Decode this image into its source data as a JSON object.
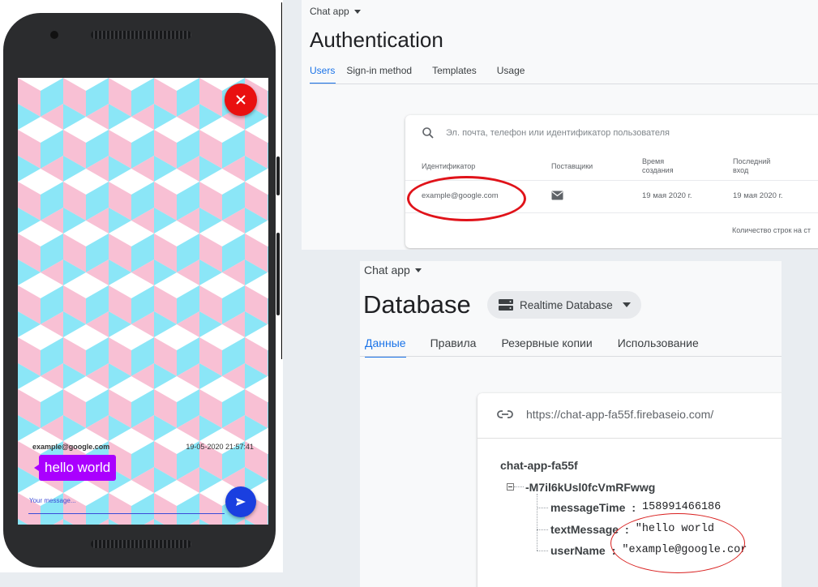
{
  "phone": {
    "close_icon": "close-icon",
    "message": {
      "user": "example@google.com",
      "time": "19-05-2020 21:57:41",
      "text": "hello world"
    },
    "input_placeholder": "Your message...",
    "send_icon": "send-icon",
    "colors": {
      "close_fab": "#e91010",
      "send_fab": "#1a3fe0",
      "bubble": "#aa00ff",
      "pattern_pink": "#f8c0d4",
      "pattern_cyan": "#8be6f7"
    }
  },
  "auth": {
    "project": "Chat app",
    "title": "Authentication",
    "tabs": [
      "Users",
      "Sign-in method",
      "Templates",
      "Usage"
    ],
    "active_tab": "Users",
    "search_placeholder": "Эл. почта, телефон или идентификатор пользователя",
    "columns": {
      "id": "Идентификатор",
      "providers": "Поставщики",
      "created": [
        "Время",
        "создания"
      ],
      "last": [
        "Последний",
        "вход"
      ]
    },
    "row": {
      "id": "example@google.com",
      "provider_icon": "mail-icon",
      "created": "19 мая 2020 г.",
      "last": "19 мая 2020 г."
    },
    "footer": "Количество строк на ст"
  },
  "database": {
    "project": "Chat app",
    "title": "Database",
    "type_selector": "Realtime Database",
    "tabs": [
      "Данные",
      "Правила",
      "Резервные копии",
      "Использование"
    ],
    "active_tab": "Данные",
    "url": "https://chat-app-fa55f.firebaseio.com/",
    "tree": {
      "root": "chat-app-fa55f",
      "node": "-M7il6kUsl0fcVmRFwwg",
      "fields": [
        {
          "key": "messageTime",
          "value": "158991466186"
        },
        {
          "key": "textMessage",
          "value": "\"hello world"
        },
        {
          "key": "userName",
          "value": "\"example@google.cor"
        }
      ]
    },
    "accent": "#1a73e8"
  }
}
